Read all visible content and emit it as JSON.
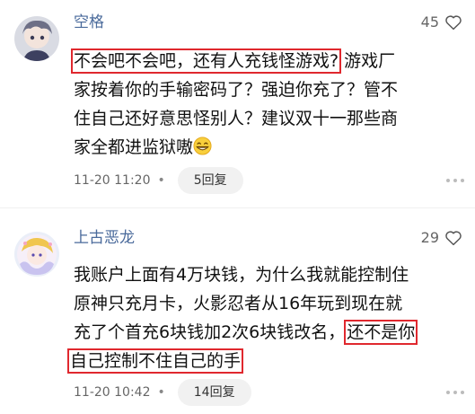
{
  "comments": [
    {
      "username": "空格",
      "likes": "45",
      "lines": [
        {
          "hl": "不会吧不会吧，还有人充钱怪游戏?",
          "rest": "游戏厂"
        },
        {
          "text": "家按着你的手输密码了？强迫你充了？管不"
        },
        {
          "text": "住自己还好意思怪别人？建议双十一那些商"
        },
        {
          "text": "家全都进监狱嗷"
        }
      ],
      "time": "11-20 11:20",
      "dot": "•",
      "replies": "5回复"
    },
    {
      "username": "上古恶龙",
      "likes": "29",
      "lines": [
        {
          "text": "我账户上面有4万块钱，为什么我就能控制住"
        },
        {
          "text": "原神只充月卡，火影忍者从16年玩到现在就"
        },
        {
          "rest_first": "充了个首充6块钱加2次6块钱改名，",
          "hl": "还不是你"
        },
        {
          "hl": "自己控制不住自己的手"
        }
      ],
      "time": "11-20 10:42",
      "dot": "•",
      "replies": "14回复"
    }
  ],
  "icons": {
    "heart": "heart-icon",
    "grin": "grinning-emoji-icon",
    "more": "more-icon"
  },
  "colors": {
    "username": "#4a6a9b",
    "highlight_box": "#e0282e"
  }
}
